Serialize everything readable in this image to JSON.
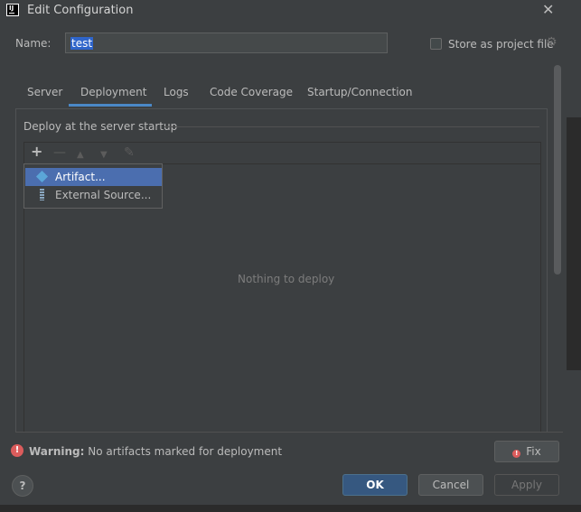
{
  "window": {
    "title": "Edit Configuration",
    "close_icon": "close-icon",
    "app_icon_text": "IJ"
  },
  "name_row": {
    "label": "Name:",
    "value": "test",
    "store_label": "Store as project file",
    "store_checked": false
  },
  "tabs": [
    {
      "label": "Server"
    },
    {
      "label": "Deployment",
      "active": true
    },
    {
      "label": "Logs"
    },
    {
      "label": "Code Coverage"
    },
    {
      "label": "Startup/Connection"
    }
  ],
  "deploy": {
    "group_title": "Deploy at the server startup",
    "toolbar": [
      "add-icon",
      "remove-icon",
      "move-up-icon",
      "move-down-icon",
      "edit-icon"
    ],
    "empty_text": "Nothing to deploy"
  },
  "popup": {
    "items": [
      {
        "label": "Artifact...",
        "icon": "artifact-icon",
        "selected": true
      },
      {
        "label": "External Source...",
        "icon": "external-source-icon",
        "selected": false
      }
    ]
  },
  "warning": {
    "bold": "Warning:",
    "text": " No artifacts marked for deployment",
    "fix_label": "Fix"
  },
  "buttons": {
    "help": "?",
    "ok": "OK",
    "cancel": "Cancel",
    "apply": "Apply"
  },
  "colors": {
    "background": "#3c3f41",
    "accent": "#4a88c7",
    "selection": "#4b6eaf",
    "error": "#db5c5c",
    "ok_button": "#365880"
  }
}
